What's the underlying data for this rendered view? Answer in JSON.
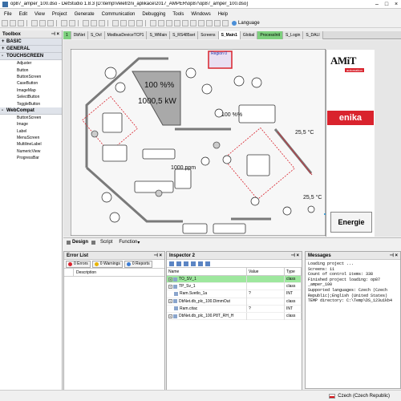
{
  "window": {
    "title": "op87_amper_100.dso - DetStudio 1.8.3  [D:\\temp\\Veletrzni_aplikace\\2017_AMPER\\op87\\op87_amper_100.dso]"
  },
  "menu": [
    "File",
    "Edit",
    "View",
    "Project",
    "Generate",
    "Communication",
    "Debugging",
    "Tools",
    "Windows",
    "Help"
  ],
  "toolbar": {
    "language_label": "Language"
  },
  "toolbox": {
    "title": "Toolbox",
    "categories": [
      {
        "sign": "+",
        "label": "BASIC"
      },
      {
        "sign": "+",
        "label": "GENERAL"
      },
      {
        "sign": "-",
        "label": "TOUCHSCREEN"
      },
      {
        "sign": "-",
        "label": "WebCompat"
      }
    ],
    "touchscreen_items": [
      "Adjuster",
      "Button",
      "ButtonScreen",
      "CaseButton",
      "ImageMap",
      "SelectButton",
      "ToggleButton"
    ],
    "webcompat_items": [
      "ButtonScreen",
      "Image",
      "Label",
      "MenuScreen",
      "MultilineLabel",
      "NumericView",
      "ProgressBar"
    ]
  },
  "doc_tabs": [
    "1",
    "DbNet",
    "S_Ovl",
    "ModbusDeviceTCP1",
    "S_WMain",
    "S_RS485set",
    "Screens",
    "S_Main1",
    "Global",
    "ProcessInit",
    "S_Login",
    "S_DALI"
  ],
  "canvas": {
    "region_label": "Region 0",
    "percent_big": "100 %%",
    "power_value": "1000,5 kW",
    "percent_small": "100 %%",
    "ppm_value": "1000 ppm",
    "temp_top": "25,5 °C",
    "temp_bottom": "25,5 °C",
    "brand_amit": "AMiT",
    "brand_amit_sub": "automation",
    "brand_enika": "enika",
    "energie_button": "Energie"
  },
  "design_bar": [
    "Design",
    "Script",
    "Function"
  ],
  "error_list": {
    "title": "Error List",
    "errors_label": "0 Errors",
    "warnings_label": "0 Warnings",
    "reports_label": "0 Reports",
    "description_col": "Description"
  },
  "inspector": {
    "title": "Inspector 2",
    "columns": [
      "Name",
      "Value",
      "Type"
    ],
    "rows": [
      {
        "name": "TO_SV_1",
        "value": "",
        "type": "class"
      },
      {
        "name": "TP_Sv_1",
        "value": "",
        "type": "class"
      },
      {
        "name": "Ram.Svetlo_1a",
        "value": "?",
        "type": "INT"
      },
      {
        "name": "DbNet.db_plc_100.DimmOut",
        "value": "",
        "type": "class"
      },
      {
        "name": "Ram.citac",
        "value": "?",
        "type": "INT"
      },
      {
        "name": "DbNet.db_plc_100.P8T_RH_H",
        "value": "",
        "type": "class"
      }
    ]
  },
  "messages": {
    "title": "Messages",
    "text": "Loading project ...\nScreens: 11\nCount of control items: 338\nFinished project loading: op87\n_amper_100\nSupported languages: Czech (Czech\nRepublic);English (United States)\nTEMP directory: C:\\Temp\\DS_123u1kb4"
  },
  "status": {
    "language": "Czech (Czech Republic)"
  },
  "colors": {
    "accent_red": "#d9232d",
    "selected_green": "#9ee79e",
    "tab_green": "#7fd07f"
  }
}
